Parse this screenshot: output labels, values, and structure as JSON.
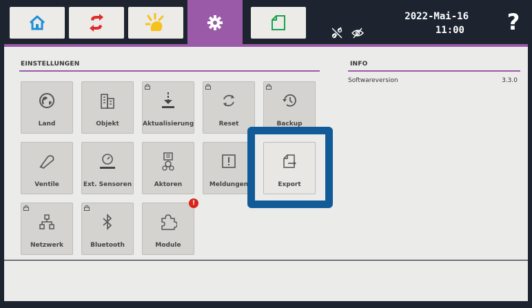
{
  "nav_tabs": [
    {
      "id": "home",
      "icon": "home-icon"
    },
    {
      "id": "exchange",
      "icon": "exchange-arrows-icon"
    },
    {
      "id": "sun",
      "icon": "sun-icon"
    },
    {
      "id": "settings",
      "icon": "gear-icon",
      "active": true
    },
    {
      "id": "green",
      "icon": "green-leaf-icon"
    }
  ],
  "header": {
    "date": "2022-Mai-16",
    "time": "11:00",
    "help_label": "?",
    "status_icons": [
      "disconnected-link-icon",
      "hidden-eye-icon"
    ]
  },
  "settings_section": {
    "title": "EINSTELLUNGEN",
    "tiles": [
      {
        "label": "Land",
        "icon": "globe-icon",
        "locked": false
      },
      {
        "label": "Objekt",
        "icon": "building-icon",
        "locked": false
      },
      {
        "label": "Aktualisierung",
        "icon": "download-icon",
        "locked": true
      },
      {
        "label": "Reset",
        "icon": "refresh-icon",
        "locked": true
      },
      {
        "label": "Backup",
        "icon": "history-icon",
        "locked": true
      },
      {
        "label": "Ventile",
        "icon": "valve-icon",
        "locked": false
      },
      {
        "label": "Ext. Sensoren",
        "icon": "sensor-icon",
        "locked": false
      },
      {
        "label": "Aktoren",
        "icon": "actuator-icon",
        "locked": false
      },
      {
        "label": "Meldungen",
        "icon": "alert-box-icon",
        "locked": false
      },
      {
        "label": "Export",
        "icon": "export-icon",
        "locked": false,
        "highlighted": true
      },
      {
        "label": "Netzwerk",
        "icon": "network-icon",
        "locked": true
      },
      {
        "label": "Bluetooth",
        "icon": "bluetooth-icon",
        "locked": true
      },
      {
        "label": "Module",
        "icon": "puzzle-icon",
        "locked": false,
        "badge": "!"
      }
    ]
  },
  "info_section": {
    "title": "INFO",
    "rows": [
      {
        "label": "Softwareversion",
        "value": "3.3.0"
      }
    ]
  },
  "colors": {
    "accent": "#9a5aa7",
    "highlight": "#115c98",
    "background_dark": "#1d2430",
    "tile": "#d4d3d0",
    "badge": "#d9241c"
  }
}
